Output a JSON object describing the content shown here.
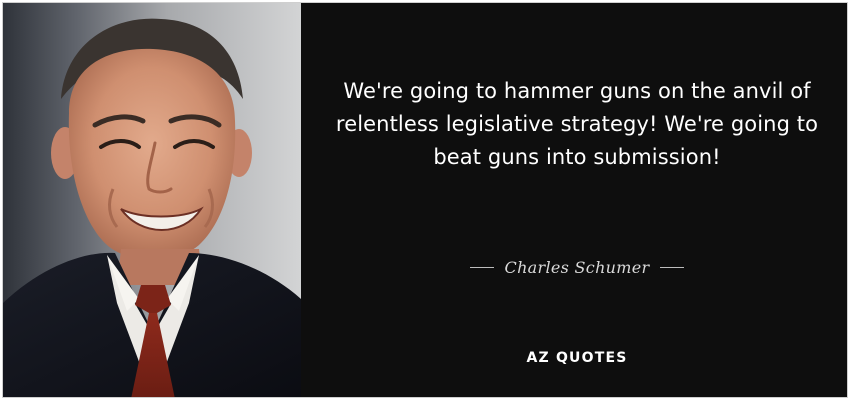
{
  "quote": {
    "text": "We're going to hammer guns on the anvil of relentless legislative strategy! We're going to beat guns into submission!",
    "author": "Charles Schumer"
  },
  "brand": {
    "logo_text": "AZ QUOTES"
  },
  "colors": {
    "background": "#0e0e0e",
    "text": "#ffffff",
    "author_text": "#d9d9d9"
  }
}
